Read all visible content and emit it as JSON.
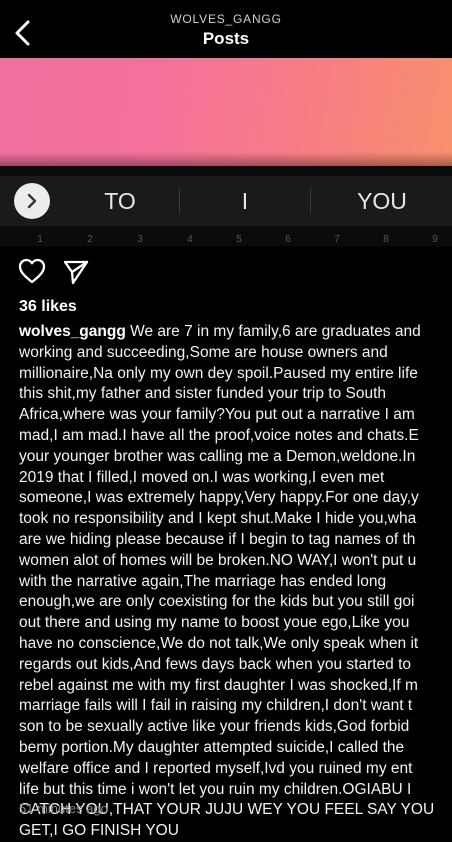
{
  "header": {
    "username": "WOLVES_GANGG",
    "title": "Posts"
  },
  "post_image": {
    "gradient_colors": [
      "#f06fa0",
      "#f77c86",
      "#f8906d"
    ],
    "suggestions": [
      "TO",
      "I",
      "YOU"
    ],
    "number_row": [
      "1",
      "2",
      "3",
      "4",
      "5",
      "6",
      "7",
      "8",
      "9"
    ]
  },
  "actions": {
    "like_icon": "heart-outline",
    "share_icon": "paper-plane"
  },
  "likes": "36 likes",
  "caption": {
    "username": "wolves_gangg",
    "first_line_text": " We are 7 in my family,6 are graduates and",
    "lines": [
      "working and succeeding,Some are house owners and",
      "millionaire,Na only my own dey spoil.Paused my entire life",
      "this shit,my father and sister funded your trip to South",
      "Africa,where was your family?You put out a narrative I am",
      "mad,I am mad.I have all the proof,voice notes and chats.E",
      "your younger brother was calling me a Demon,weldone.In",
      "2019 that I filled,I moved on.I was working,I even met",
      "someone,I was extremely happy,Very happy.For one day,y",
      "took no responsibility and I kept shut.Make I hide you,wha",
      "are we hiding please because if I begin to tag names of th",
      "women alot of homes will be broken.NO WAY,I won't put u",
      "with the narrative again,The marriage has ended long",
      "enough,we are only coexisting for the kids but you still goi",
      "out there and using my name to boost youe ego,Like you",
      "have no conscience,We do not talk,We only speak when it",
      "regards out kids,And fews days back when you started to",
      "rebel against me with my first daughter I was shocked,If m",
      "marriage fails will I fail in raising my children,I don't want t",
      "son to be sexually active like your friends kids,God forbid",
      "bemy portion.My daughter attempted suicide,I called the",
      "welfare office and I reported myself,Ivd you ruined my ent",
      "life but this time i won't let you ruin my children.OGIABU I",
      "CATCH YOU,THAT YOUR JUJU WEY YOU FEEL SAY YOU",
      "GET,I GO FINISH YOU"
    ]
  },
  "timestamp": "51 minutes ago"
}
